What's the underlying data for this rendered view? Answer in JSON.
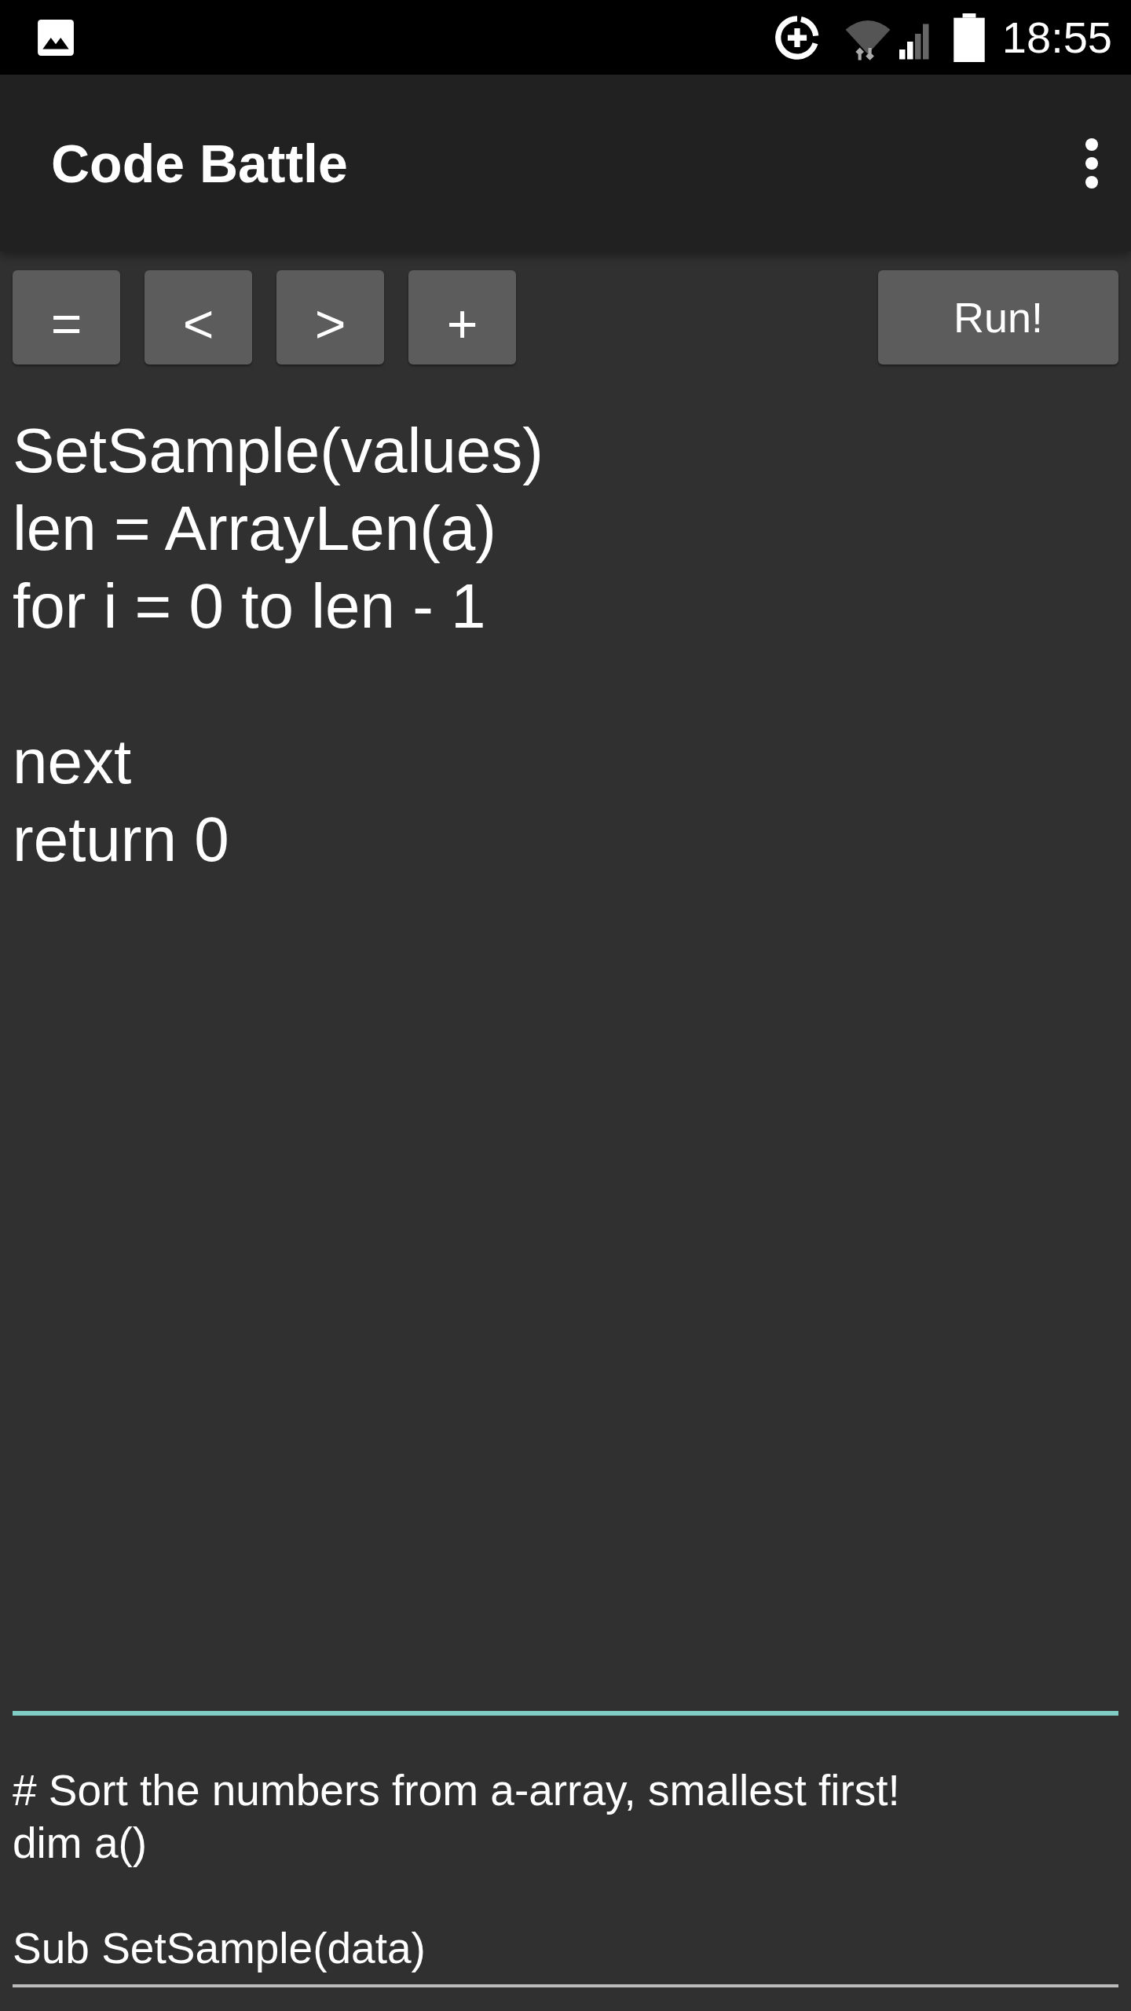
{
  "status_bar": {
    "time": "18:55"
  },
  "app_bar": {
    "title": "Code Battle"
  },
  "toolbar": {
    "keys": [
      "=",
      "<",
      ">",
      "+"
    ],
    "run_button": "Run!"
  },
  "editor": {
    "code": "SetSample(values)\nlen = ArrayLen(a)\nfor i = 0 to len - 1\n\nnext\nreturn 0"
  },
  "task": {
    "text": "# Sort the numbers from a-array, smallest first!\ndim a()\n\nSub SetSample(data)"
  }
}
